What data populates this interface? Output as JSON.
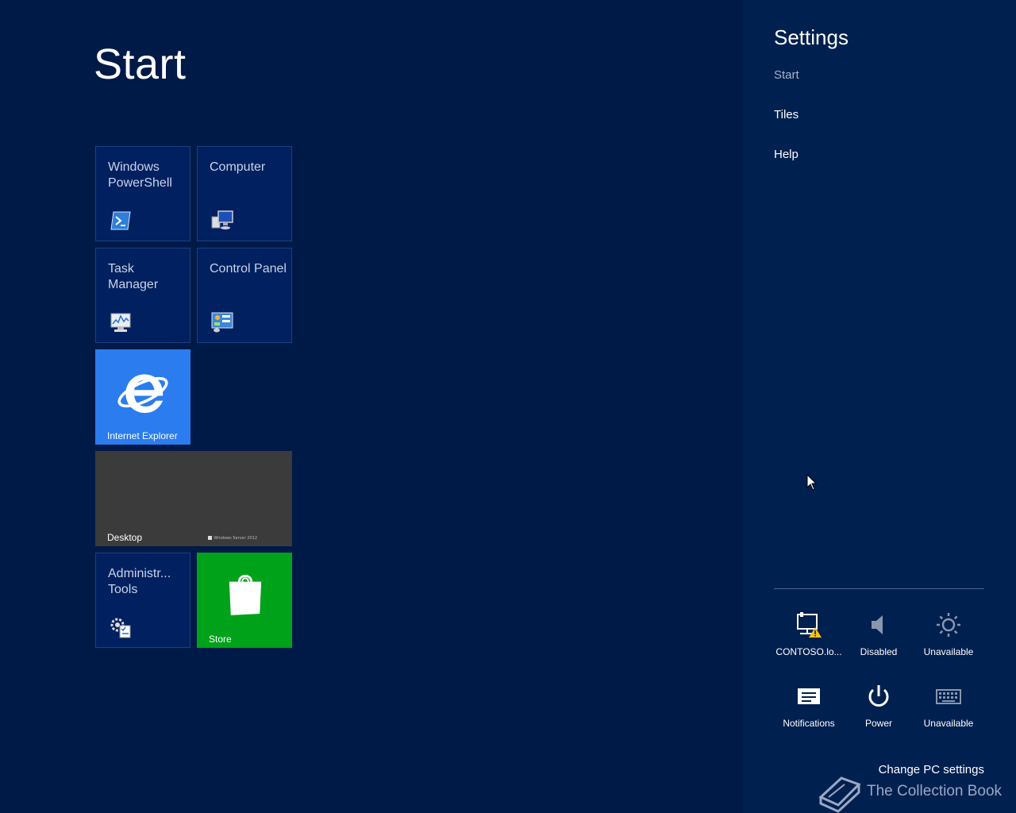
{
  "start": {
    "title": "Start"
  },
  "tiles": {
    "powershell": {
      "label": "Windows PowerShell",
      "icon": "powershell-icon"
    },
    "computer": {
      "label": "Computer",
      "icon": "computer-icon"
    },
    "task_manager": {
      "label": "Task Manager",
      "icon": "task-manager-icon"
    },
    "control_panel": {
      "label": "Control Panel",
      "icon": "control-panel-icon"
    },
    "internet_explorer": {
      "label": "Internet Explorer",
      "icon": "internet-explorer-icon",
      "color": "#2a7cef"
    },
    "desktop": {
      "label": "Desktop",
      "wallpaper_text": "Windows Server 2012",
      "color": "#3b3b3b"
    },
    "admin_tools": {
      "label": "Administr... Tools",
      "icon": "admin-tools-icon"
    },
    "store": {
      "label": "Store",
      "icon": "store-bag-icon",
      "color": "#00a21a"
    }
  },
  "charms": {
    "title": "Settings",
    "links": {
      "start": "Start",
      "tiles": "Tiles",
      "help": "Help"
    },
    "quick_settings": {
      "network": {
        "label": "CONTOSO.lo...",
        "icon": "network-warning-icon"
      },
      "volume": {
        "label": "Disabled",
        "icon": "speaker-icon"
      },
      "brightness": {
        "label": "Unavailable",
        "icon": "brightness-icon"
      },
      "notifications": {
        "label": "Notifications",
        "icon": "notifications-icon"
      },
      "power": {
        "label": "Power",
        "icon": "power-icon"
      },
      "keyboard": {
        "label": "Unavailable",
        "icon": "keyboard-icon"
      }
    },
    "change_pc_settings": "Change PC settings"
  },
  "watermark": {
    "text": "The Collection Book",
    "icon": "book-icon"
  },
  "colors": {
    "background": "#001a48",
    "charms_background": "#00204f",
    "tile_dark": "#012060"
  }
}
